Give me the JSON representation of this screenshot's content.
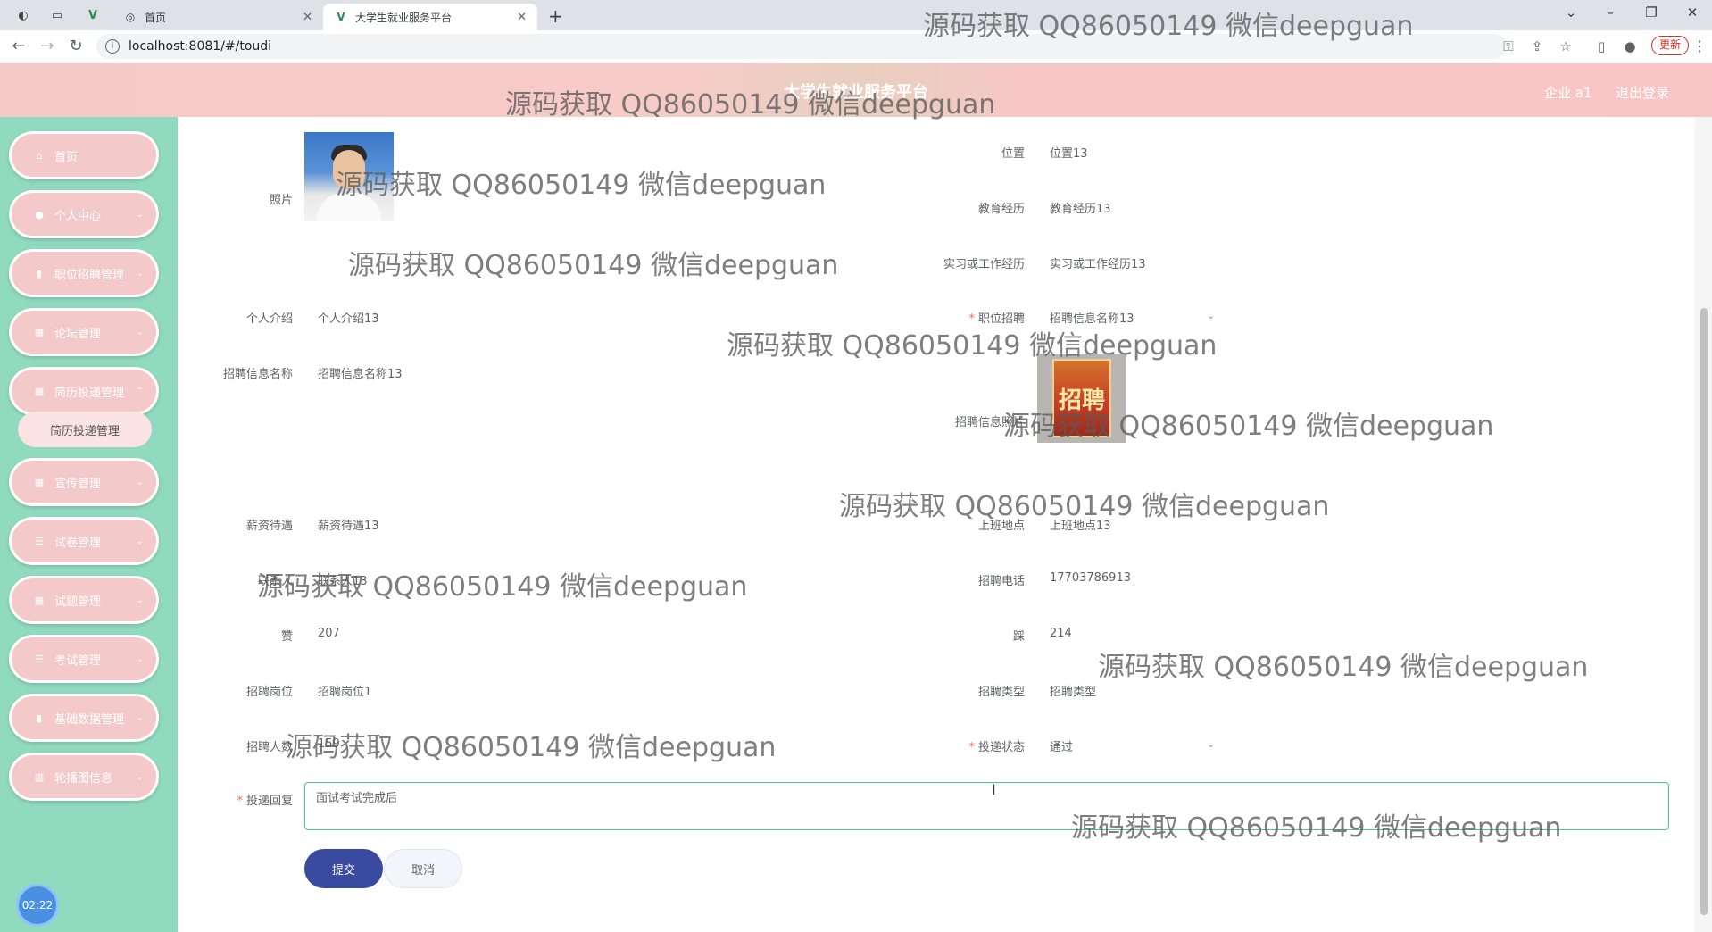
{
  "browser": {
    "tabs": [
      {
        "title": "首页"
      },
      {
        "title": "大学生就业服务平台"
      }
    ],
    "url": "localhost:8081/#/toudi",
    "update_label": "更新"
  },
  "header": {
    "title": "大学生就业服务平台",
    "user_label": "企业 a1",
    "logout_label": "退出登录",
    "bg_color": "#f6c9c7"
  },
  "sidebar": {
    "bg_color": "#90dbbf",
    "items": [
      {
        "label": "首页",
        "icon": "home-icon"
      },
      {
        "label": "个人中心",
        "icon": "user-icon"
      },
      {
        "label": "职位招聘管理",
        "icon": "clipboard-icon"
      },
      {
        "label": "论坛管理",
        "icon": "grid-icon"
      },
      {
        "label": "简历投递管理",
        "icon": "grid-icon"
      },
      {
        "label": "宣传管理",
        "icon": "grid-icon"
      },
      {
        "label": "试卷管理",
        "icon": "list-icon"
      },
      {
        "label": "试题管理",
        "icon": "grid-icon"
      },
      {
        "label": "考试管理",
        "icon": "list-icon"
      },
      {
        "label": "基础数据管理",
        "icon": "clipboard-icon"
      },
      {
        "label": "轮播图信息",
        "icon": "chart-icon"
      }
    ],
    "active_submenu": "简历投递管理",
    "clock": "02:22"
  },
  "form": {
    "photo_label": "照片",
    "position_label": "位置",
    "position_value": "位置13",
    "education_label": "教育经历",
    "education_value": "教育经历13",
    "work_label": "实习或工作经历",
    "work_value": "实习或工作经历13",
    "intro_label": "个人介绍",
    "intro_value": "个人介绍13",
    "job_label": "职位招聘",
    "job_value": "招聘信息名称13",
    "recruit_name_label": "招聘信息名称",
    "recruit_name_value": "招聘信息名称13",
    "recruit_photo_label": "招聘信息照片",
    "poster_text": "招聘",
    "salary_label": "薪资待遇",
    "salary_value": "薪资待遇13",
    "workplace_label": "上班地点",
    "workplace_value": "上班地点13",
    "contact_label": "联系人",
    "contact_value": "联系人13",
    "phone_label": "招聘电话",
    "phone_value": "17703786913",
    "like_label": "赞",
    "like_value": "207",
    "dislike_label": "踩",
    "dislike_value": "214",
    "post_label": "招聘岗位",
    "post_value": "招聘岗位1",
    "type_label": "招聘类型",
    "type_value": "招聘类型",
    "count_label": "招聘人数",
    "count_value": "159",
    "status_label": "投递状态",
    "status_value": "通过",
    "reply_label": "投递回复",
    "reply_value": "面试考试完成后",
    "submit_label": "提交",
    "cancel_label": "取消"
  },
  "watermark": "源码获取 QQ86050149 微信deepguan"
}
